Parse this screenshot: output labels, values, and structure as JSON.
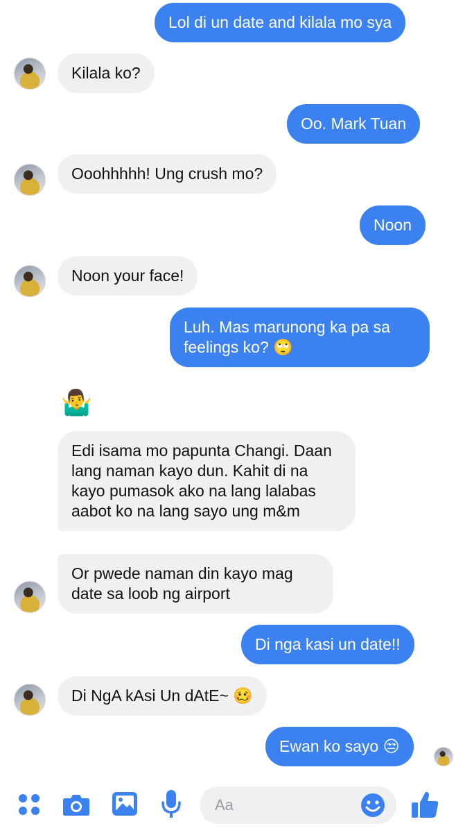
{
  "accent_color": "#3b82f0",
  "incoming_bubble_color": "#f0f0f2",
  "messages": [
    {
      "dir": "out",
      "text": "Lol di un date and kilala mo sya"
    },
    {
      "dir": "in",
      "text": "Kilala ko?"
    },
    {
      "dir": "out",
      "text": "Oo. Mark Tuan"
    },
    {
      "dir": "in",
      "text": "Ooohhhhh! Ung crush mo?"
    },
    {
      "dir": "out",
      "text": "Noon"
    },
    {
      "dir": "in",
      "text": "Noon your face!"
    },
    {
      "dir": "out",
      "text": "Luh. Mas marunong ka pa sa feelings ko? 🙄"
    },
    {
      "dir": "in",
      "text": "🤷‍♂️",
      "kind": "emoji"
    },
    {
      "dir": "in",
      "text": "Edi isama mo papunta Changi. Daan lang naman kayo dun. Kahit di na kayo pumasok ako na lang lalabas aabot ko na lang sayo ung m&m"
    },
    {
      "dir": "in",
      "text": "Or pwede naman din kayo mag date sa loob ng airport"
    },
    {
      "dir": "out",
      "text": "Di nga kasi un date!!"
    },
    {
      "dir": "in",
      "text": "Di NgA kAsi Un dAtE~ 🥴"
    },
    {
      "dir": "out",
      "text": "Ewan ko sayo 😒"
    }
  ],
  "composer": {
    "placeholder": "Aa"
  },
  "toolbar_icons": [
    "more-dots-icon",
    "camera-icon",
    "gallery-icon",
    "microphone-icon",
    "emoji-icon",
    "thumbs-up-icon"
  ]
}
